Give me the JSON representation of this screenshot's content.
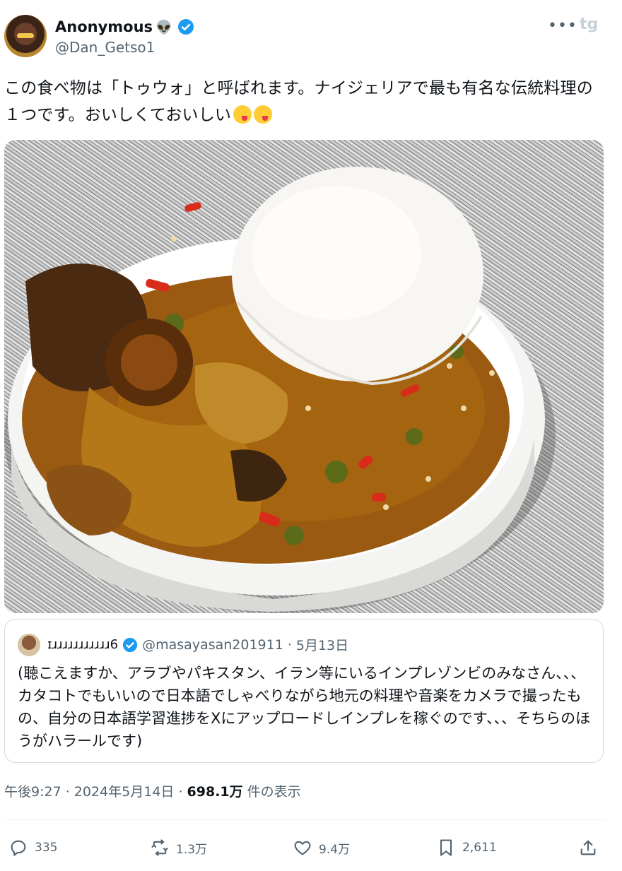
{
  "author": {
    "name": "Anonymous",
    "emoji": "👽",
    "handle": "@Dan_Getso1"
  },
  "watermark": "tg",
  "tweet_text": "この食べ物は「トゥウォ」と呼ばれます。ナイジェリアで最も有名な伝統料理の１つです。おいしくておいしい",
  "quote": {
    "name": "ɪɹɹɹɹɹɹɹɹɹɹɹ6",
    "handle": "@masayasan201911",
    "separator": "·",
    "date": "5月13日",
    "text": "(聴こえますか、アラブやパキスタン、イラン等にいるインプレゾンビのみなさん、、、カタコトでもいいので日本語でしゃべりながら地元の料理や音楽をカメラで撮ったもの、自分の日本語学習進捗をXにアップロードしインプレを稼ぐのです、、、そちらのほうがハラールです)"
  },
  "meta": {
    "time": "午後9:27 · 2024年5月14日 · ",
    "views": "698.1万",
    "views_label": " 件の表示"
  },
  "actions": {
    "replies": "335",
    "reposts": "1.3万",
    "likes": "9.4万",
    "bookmarks": "2,611"
  },
  "colors": {
    "verified": "#1d9bf0",
    "text": "#0f1419",
    "secondary": "#536471"
  }
}
